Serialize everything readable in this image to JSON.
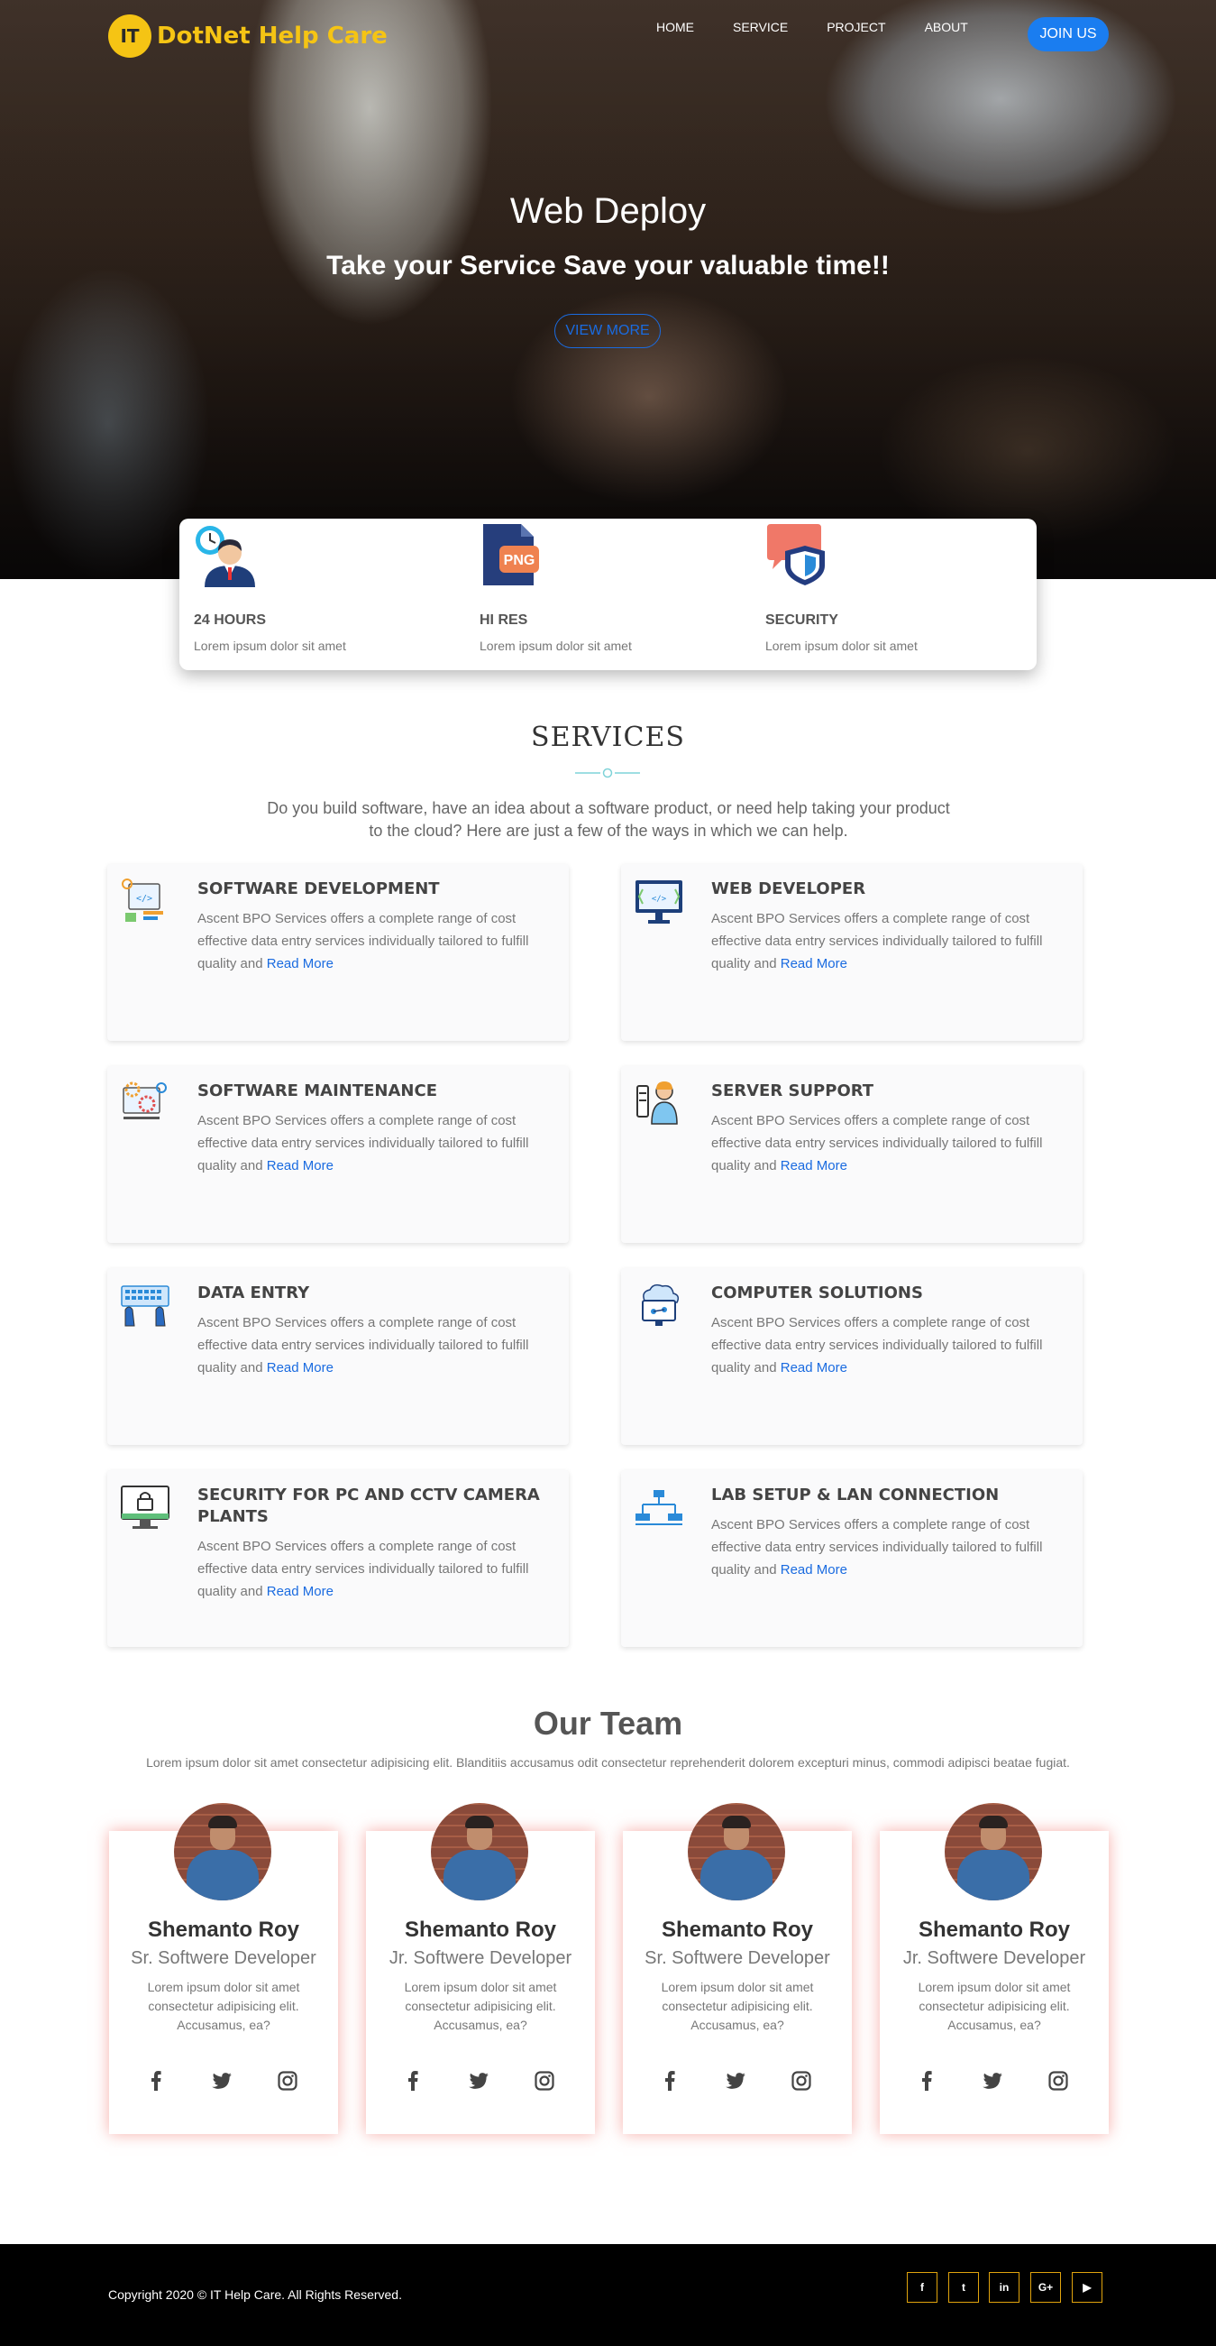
{
  "header": {
    "logo_mark": "IT",
    "logo_text": "DotNet Help Care",
    "nav": [
      "HOME",
      "SERVICE",
      "PROJECT",
      "ABOUT"
    ],
    "join_label": "JOIN US"
  },
  "hero": {
    "title": "Web Deploy",
    "subtitle": "Take your Service Save your valuable time!!",
    "cta_label": "VIEW MORE"
  },
  "features": [
    {
      "title": "24 HOURS",
      "text": "Lorem ipsum dolor sit amet",
      "icon": "support-agent-clock-icon"
    },
    {
      "title": "HI RES",
      "text": "Lorem ipsum dolor sit amet",
      "icon": "png-file-icon",
      "badge": "PNG"
    },
    {
      "title": "SECURITY",
      "text": "Lorem ipsum dolor sit amet",
      "icon": "chat-shield-icon"
    }
  ],
  "services": {
    "title": "SERVICES",
    "intro": "Do you build software, have an idea about a software product, or need help taking your product to the cloud? Here are just a few of the ways in which we can help.",
    "desc": "Ascent BPO Services offers a complete range of cost effective data entry services individually tailored to fulfill quality and",
    "read_more": "Read More",
    "items": [
      {
        "title": "SOFTWARE DEVELOPMENT",
        "icon": "software-development-icon"
      },
      {
        "title": "WEB DEVELOPER",
        "icon": "web-developer-icon"
      },
      {
        "title": "SOFTWARE MAINTENANCE",
        "icon": "software-maintenance-icon"
      },
      {
        "title": "SERVER SUPPORT",
        "icon": "server-support-icon"
      },
      {
        "title": "DATA ENTRY",
        "icon": "data-entry-icon"
      },
      {
        "title": "COMPUTER SOLUTIONS",
        "icon": "computer-solutions-icon"
      },
      {
        "title": "SECURITY FOR PC AND CCTV CAMERA PLANTS",
        "icon": "security-monitor-icon"
      },
      {
        "title": "LAB SETUP & LAN CONNECTION",
        "icon": "lan-network-icon"
      }
    ]
  },
  "team": {
    "title": "Our Team",
    "intro": "Lorem ipsum dolor sit amet consectetur adipisicing elit. Blanditiis accusamus odit consectetur reprehenderit dolorem excepturi minus, commodi adipisci beatae fugiat.",
    "members": [
      {
        "name": "Shemanto Roy",
        "role": "Sr. Softwere Developer",
        "desc": "Lorem ipsum dolor sit amet consectetur adipisicing elit. Accusamus, ea?"
      },
      {
        "name": "Shemanto Roy",
        "role": "Jr. Softwere Developer",
        "desc": "Lorem ipsum dolor sit amet consectetur adipisicing elit. Accusamus, ea?"
      },
      {
        "name": "Shemanto Roy",
        "role": "Sr. Softwere Developer",
        "desc": "Lorem ipsum dolor sit amet consectetur adipisicing elit. Accusamus, ea?"
      },
      {
        "name": "Shemanto Roy",
        "role": "Jr. Softwere Developer",
        "desc": "Lorem ipsum dolor sit amet consectetur adipisicing elit. Accusamus, ea?"
      }
    ],
    "social_icons": [
      "facebook-icon",
      "twitter-icon",
      "instagram-icon"
    ]
  },
  "footer": {
    "copyright": "Copyright 2020 © IT Help Care. All Rights Reserved.",
    "social": [
      {
        "icon": "facebook-icon",
        "glyph": "f"
      },
      {
        "icon": "twitter-icon",
        "glyph": "t"
      },
      {
        "icon": "linkedin-icon",
        "glyph": "in"
      },
      {
        "icon": "google-plus-icon",
        "glyph": "G+"
      },
      {
        "icon": "youtube-icon",
        "glyph": "▶"
      }
    ]
  },
  "colors": {
    "accent": "#1a7df0",
    "brand_yellow": "#f5c414",
    "footer_border": "#e0a30d",
    "card_glow": "#f06e64"
  }
}
